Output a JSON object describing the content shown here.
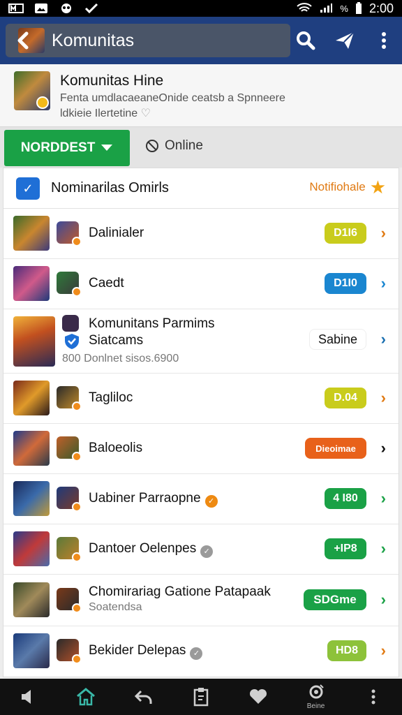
{
  "status_bar": {
    "time": "2:00",
    "battery": "%"
  },
  "app_bar": {
    "title": "Komunitas"
  },
  "community": {
    "name": "Komunitas Hine",
    "desc_line1": "Fenta umdlacaeaneOnide ceatsb a Spnneere",
    "desc_line2": "ldkieie Ilertetine"
  },
  "filter": {
    "dropdown_label": "NORDDEST",
    "online_label": "Online"
  },
  "list_header": {
    "title": "Nominarilas Omirls",
    "right_label": "Notifiohale"
  },
  "rows": [
    {
      "name": "Dalinialer",
      "badge": "D1I6",
      "badge_color": "#c9cc1c",
      "chev_color": "#e07a13"
    },
    {
      "name": "Caedt",
      "badge": "D1I0",
      "badge_color": "#1a86d0",
      "chev_color": "#1a86d0"
    },
    {
      "name": "Komunitans Parmims",
      "name2": "Siatcams",
      "sub": "800 Donlnet sisos.6900",
      "badge": "Sabine",
      "badge_color": "#ffffff",
      "chev_color": "#1a6fb0"
    },
    {
      "name": "Tagliloc",
      "badge": "D.04",
      "badge_color": "#c9cc1c",
      "chev_color": "#e07a13"
    },
    {
      "name": "Baloeolis",
      "badge": "Dieoimae",
      "badge_color": "#e8611a",
      "chev_color": "#111111"
    },
    {
      "name": "Uabiner Parraopne",
      "badge": "4 I80",
      "badge_color": "#1aa146",
      "chev_color": "#1aa146"
    },
    {
      "name": "Dantoer Oelenpes",
      "badge": "+IP8",
      "badge_color": "#1aa146",
      "chev_color": "#1aa146"
    },
    {
      "name": "Chomirariag Gatione Patapaak",
      "sub": "Soatendsa",
      "badge": "SDGme",
      "badge_color": "#1aa146",
      "chev_color": "#1aa146"
    },
    {
      "name": "Bekider Delepas",
      "badge": "HD8",
      "badge_color": "#8dc23a",
      "chev_color": "#e07a13"
    }
  ],
  "bottom_nav": {
    "last_label": "Beine"
  },
  "icons": {
    "back": "back-arrow-icon",
    "search": "search-icon",
    "send": "send-icon",
    "more": "more-vert-icon",
    "verified": "verified-check-icon",
    "star": "star-icon"
  },
  "colors": {
    "app_bar": "#1f3f80",
    "accent_green": "#1aa146",
    "accent_orange": "#e07a13"
  }
}
